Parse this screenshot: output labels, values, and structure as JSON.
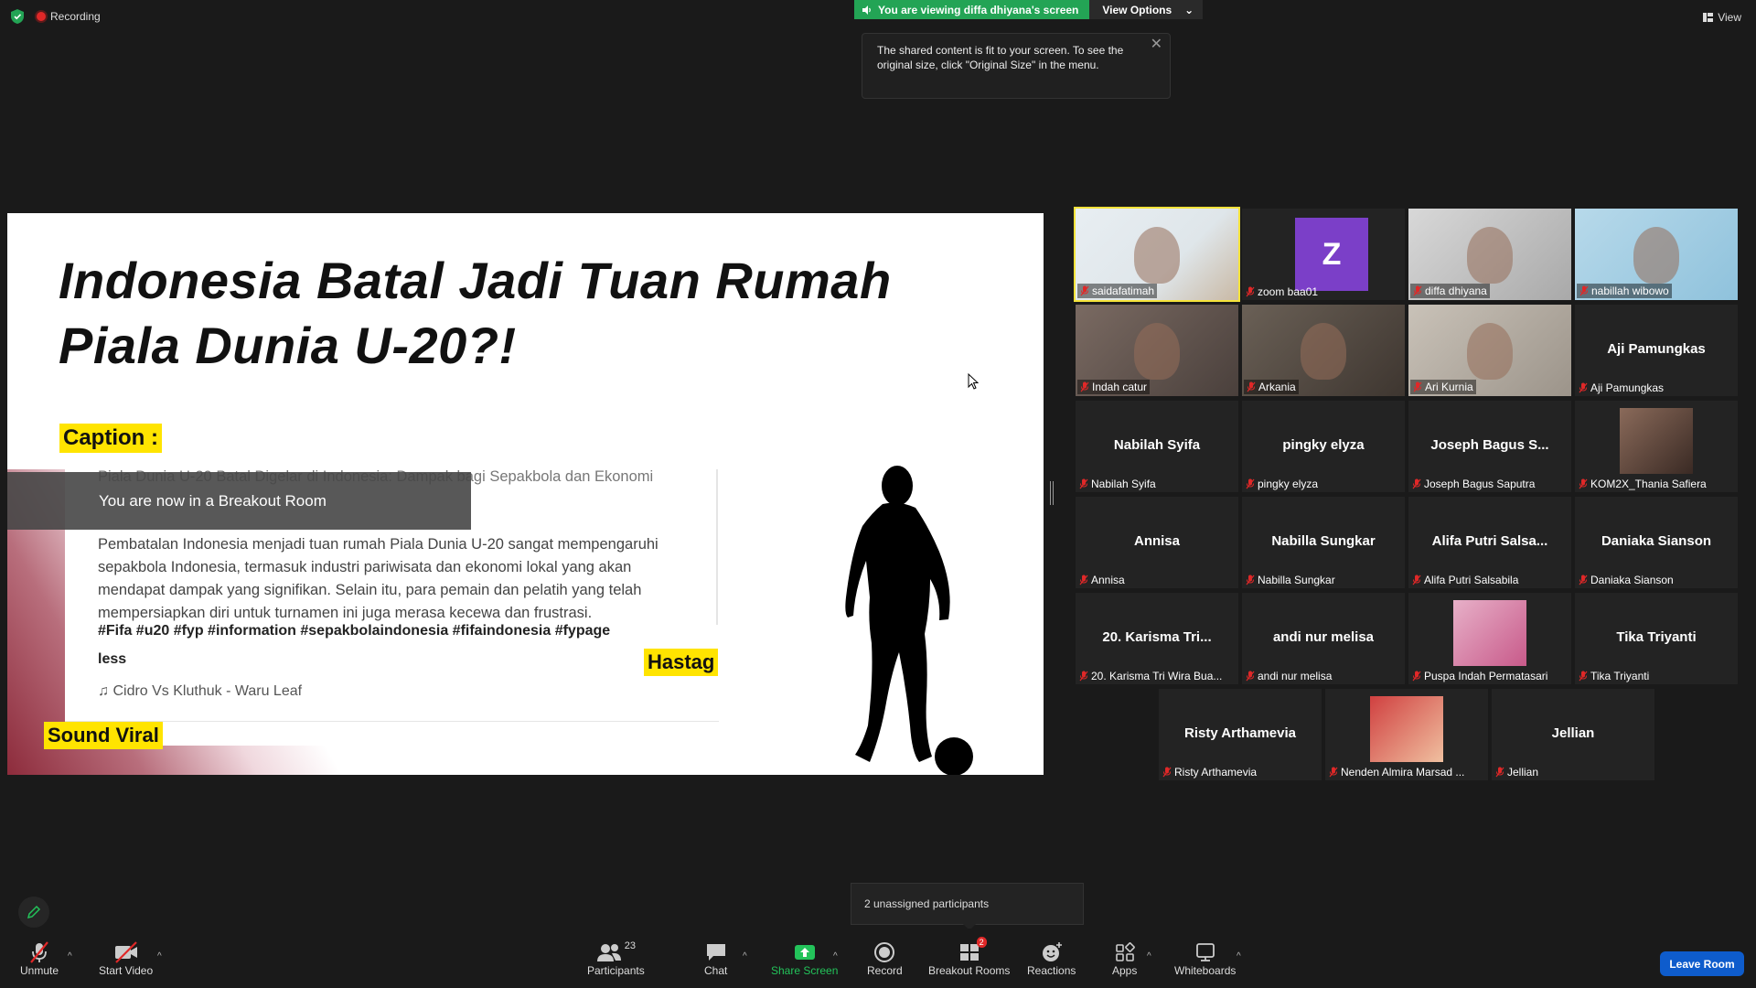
{
  "top": {
    "recording_label": "Recording",
    "viewing_banner": "You are viewing diffa dhiyana's screen",
    "view_options_label": "View Options",
    "view_label": "View"
  },
  "tooltip": {
    "text": "The shared content is fit to your screen. To see the original size, click \"Original Size\" in the menu."
  },
  "slide": {
    "title_line1": "Indonesia Batal Jadi Tuan Rumah",
    "title_line2": "Piala Dunia U-20?!",
    "caption_tag": "Caption :",
    "caption_line1": "Piala Dunia U-20 Batal Digelar di Indonesia: Dampak bagi Sepakbola dan Ekonomi",
    "caption_body": "Pembatalan Indonesia menjadi tuan rumah Piala Dunia U-20 sangat mempengaruhi sepakbola Indonesia, termasuk industri pariwisata dan ekonomi lokal yang akan mendapat dampak yang signifikan. Selain itu, para pemain dan pelatih yang telah mempersiapkan diri untuk turnamen ini juga merasa kecewa dan frustrasi.",
    "hashtags": "#Fifa #u20 #fyp #information #sepakbolaindonesia #fifaindonesia #fypage",
    "less_label": "less",
    "music": "Cidro Vs Kluthuk - Waru Leaf",
    "hastag_tag": "Hastag",
    "sound_tag": "Sound Viral",
    "breakout_toast": "You are now in a Breakout Room"
  },
  "gallery": [
    {
      "label": "saidafatimah",
      "center": "",
      "type": "photo"
    },
    {
      "label": "zoom baa01",
      "center": "",
      "type": "avatar",
      "avatar_letter": "Z"
    },
    {
      "label": "diffa dhiyana",
      "center": "",
      "type": "photo"
    },
    {
      "label": "nabillah wibowo",
      "center": "",
      "type": "photo"
    },
    {
      "label": "Indah catur",
      "center": "",
      "type": "photo"
    },
    {
      "label": "Arkania",
      "center": "",
      "type": "photo"
    },
    {
      "label": "Ari Kurnia",
      "center": "",
      "type": "photo"
    },
    {
      "label": "Aji Pamungkas",
      "center": "Aji Pamungkas",
      "type": "name"
    },
    {
      "label": "Nabilah Syifa",
      "center": "Nabilah Syifa",
      "type": "name"
    },
    {
      "label": "pingky elyza",
      "center": "pingky elyza",
      "type": "name"
    },
    {
      "label": "Joseph Bagus Saputra",
      "center": "Joseph Bagus S...",
      "type": "name"
    },
    {
      "label": "KOM2X_Thania Safiera",
      "center": "",
      "type": "thumb"
    },
    {
      "label": "Annisa",
      "center": "Annisa",
      "type": "name"
    },
    {
      "label": "Nabilla Sungkar",
      "center": "Nabilla Sungkar",
      "type": "name"
    },
    {
      "label": "Alifa Putri Salsabila",
      "center": "Alifa Putri Salsa...",
      "type": "name"
    },
    {
      "label": "Daniaka Sianson",
      "center": "Daniaka Sianson",
      "type": "name"
    },
    {
      "label": "20. Karisma Tri Wira Bua...",
      "center": "20. Karisma Tri...",
      "type": "name"
    },
    {
      "label": "andi nur melisa",
      "center": "andi nur melisa",
      "type": "name"
    },
    {
      "label": "Puspa Indah Permatasari",
      "center": "",
      "type": "thumb"
    },
    {
      "label": "Tika Triyanti",
      "center": "Tika Triyanti",
      "type": "name"
    },
    {
      "label": "Risty Arthamevia",
      "center": "Risty Arthamevia",
      "type": "name"
    },
    {
      "label": "Nenden Almira Marsad ...",
      "center": "",
      "type": "thumb"
    },
    {
      "label": "Jellian",
      "center": "Jellian",
      "type": "name"
    }
  ],
  "toolbar": {
    "unmute": "Unmute",
    "start_video": "Start Video",
    "participants": "Participants",
    "participants_count": "23",
    "chat": "Chat",
    "share_screen": "Share Screen",
    "record": "Record",
    "breakout_rooms": "Breakout Rooms",
    "breakout_badge": "2",
    "reactions": "Reactions",
    "apps": "Apps",
    "whiteboards": "Whiteboards",
    "leave_room": "Leave Room",
    "unassigned_popup": "2 unassigned participants"
  },
  "colors": {
    "accent_green": "#23a455",
    "leave_blue": "#0e5ccc",
    "highlight_yellow": "#ffe400",
    "active_speaker": "#f5e33a",
    "avatar_purple": "#7b3fc8"
  }
}
